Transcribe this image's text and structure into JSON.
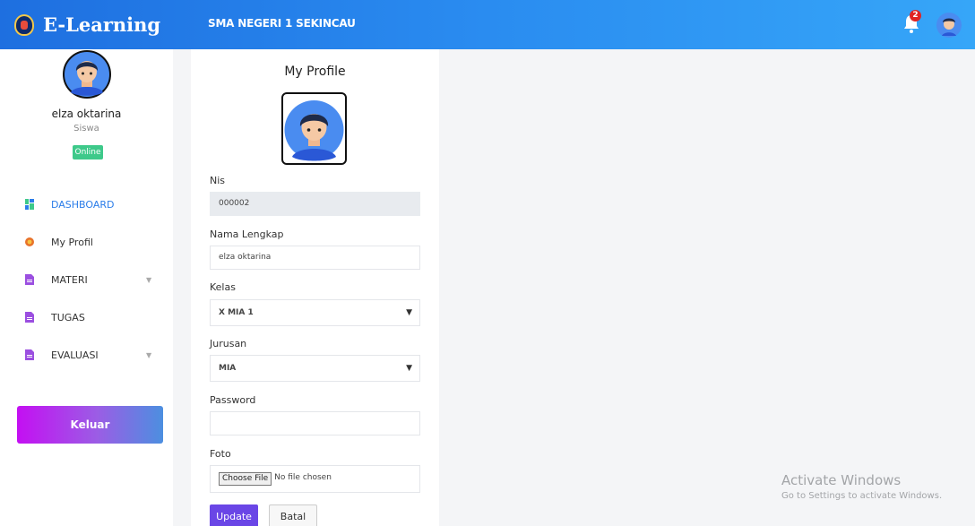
{
  "header": {
    "brand": "E-Learning",
    "school": "SMA NEGERI 1 SEKINCAU",
    "notification_count": "2"
  },
  "sidebar": {
    "user_name": "elza oktarina",
    "role": "Siswa",
    "status": "Online",
    "items": [
      {
        "label": "DASHBOARD",
        "icon": "dashboard-icon",
        "active": true
      },
      {
        "label": "My Profil",
        "icon": "profile-icon"
      },
      {
        "label": "MATERI",
        "icon": "document-icon",
        "has_caret": true
      },
      {
        "label": "TUGAS",
        "icon": "document-icon"
      },
      {
        "label": "EVALUASI",
        "icon": "document-icon",
        "has_caret": true
      }
    ],
    "logout_label": "Keluar"
  },
  "profile": {
    "title": "My Profile",
    "nis_label": "Nis",
    "nis_value": "000002",
    "name_label": "Nama Lengkap",
    "name_value": "elza oktarina",
    "kelas_label": "Kelas",
    "kelas_value": "X MIA 1",
    "jurusan_label": "Jurusan",
    "jurusan_value": "MIA",
    "password_label": "Password",
    "password_value": "",
    "foto_label": "Foto",
    "file_button": "Choose File",
    "file_status": "No file chosen",
    "update_label": "Update",
    "cancel_label": "Batal"
  },
  "watermark": {
    "title": "Activate Windows",
    "subtitle": "Go to Settings to activate Windows."
  },
  "colors": {
    "header_start": "#1e6fe0",
    "header_end": "#36a6f8",
    "active_menu": "#2b7de9",
    "online": "#3ec98a",
    "update_button": "#6a46e6"
  }
}
